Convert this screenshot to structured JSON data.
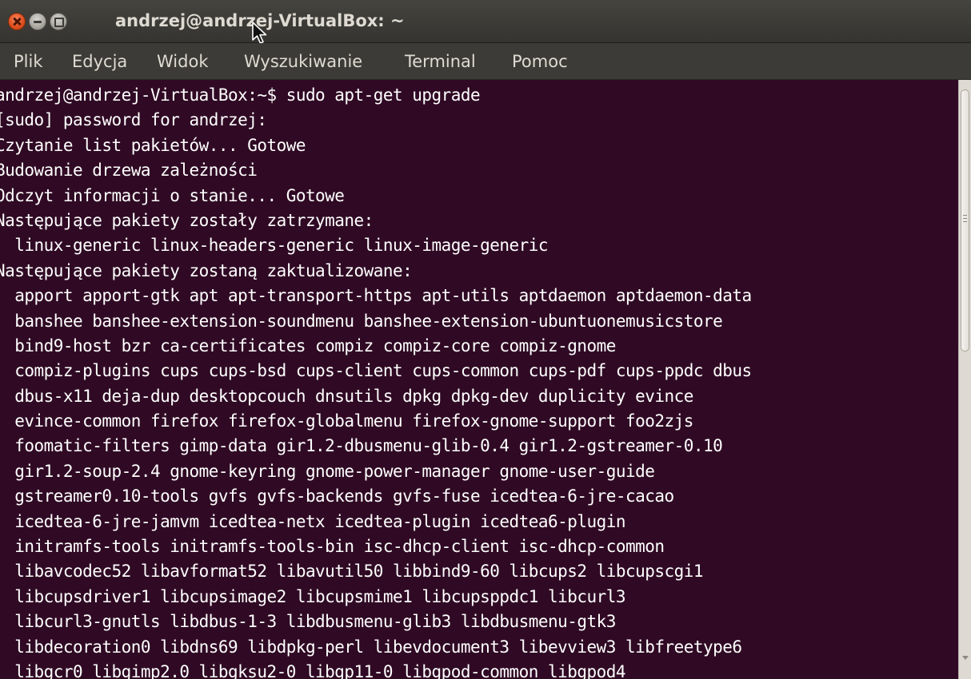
{
  "window": {
    "title": "andrzej@andrzej-VirtualBox: ~"
  },
  "menu": {
    "items": [
      "Plik",
      "Edycja",
      "Widok",
      "Wyszukiwanie",
      "Terminal",
      "Pomoc"
    ]
  },
  "terminal": {
    "lines": [
      "andrzej@andrzej-VirtualBox:~$ sudo apt-get upgrade",
      "[sudo] password for andrzej:",
      "Czytanie list pakietów... Gotowe",
      "Budowanie drzewa zależności",
      "Odczyt informacji o stanie... Gotowe",
      "Następujące pakiety zostały zatrzymane:",
      "  linux-generic linux-headers-generic linux-image-generic",
      "Następujące pakiety zostaną zaktualizowane:",
      "  apport apport-gtk apt apt-transport-https apt-utils aptdaemon aptdaemon-data",
      "  banshee banshee-extension-soundmenu banshee-extension-ubuntuonemusicstore",
      "  bind9-host bzr ca-certificates compiz compiz-core compiz-gnome",
      "  compiz-plugins cups cups-bsd cups-client cups-common cups-pdf cups-ppdc dbus",
      "  dbus-x11 deja-dup desktopcouch dnsutils dpkg dpkg-dev duplicity evince",
      "  evince-common firefox firefox-globalmenu firefox-gnome-support foo2zjs",
      "  foomatic-filters gimp-data gir1.2-dbusmenu-glib-0.4 gir1.2-gstreamer-0.10",
      "  gir1.2-soup-2.4 gnome-keyring gnome-power-manager gnome-user-guide",
      "  gstreamer0.10-tools gvfs gvfs-backends gvfs-fuse icedtea-6-jre-cacao",
      "  icedtea-6-jre-jamvm icedtea-netx icedtea-plugin icedtea6-plugin",
      "  initramfs-tools initramfs-tools-bin isc-dhcp-client isc-dhcp-common",
      "  libavcodec52 libavformat52 libavutil50 libbind9-60 libcups2 libcupscgi1",
      "  libcupsdriver1 libcupsimage2 libcupsmime1 libcupsppdc1 libcurl3",
      "  libcurl3-gnutls libdbus-1-3 libdbusmenu-glib3 libdbusmenu-gtk3",
      "  libdecoration0 libdns69 libdpkg-perl libevdocument3 libevview3 libfreetype6",
      "  libgcr0 libgimp2.0 libgksu2-0 libgp11-0 libgpod-common libgpod4"
    ]
  }
}
